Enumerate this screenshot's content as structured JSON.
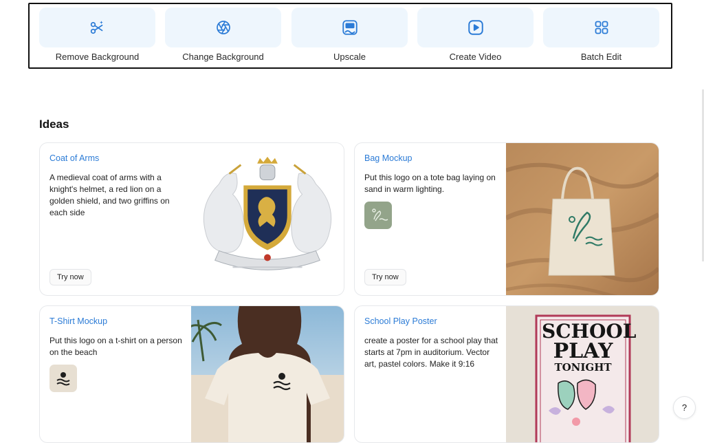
{
  "tools": [
    {
      "label": "Remove Background",
      "icon": "scissors-sparkle-icon"
    },
    {
      "label": "Change Background",
      "icon": "aperture-icon"
    },
    {
      "label": "Upscale",
      "icon": "hd-icon"
    },
    {
      "label": "Create Video",
      "icon": "play-icon"
    },
    {
      "label": "Batch Edit",
      "icon": "grid-icon"
    }
  ],
  "ideas": {
    "title": "Ideas",
    "cards": [
      {
        "title": "Coat of Arms",
        "description": "A medieval coat of arms with a knight's helmet, a red lion on a golden shield, and two griffins on each side",
        "button": "Try now"
      },
      {
        "title": "Bag Mockup",
        "description": "Put this logo on a tote bag laying on sand in warm lighting.",
        "button": "Try now"
      },
      {
        "title": "T-Shirt Mockup",
        "description": "Put this logo on a t-shirt on a person on the beach"
      },
      {
        "title": "School Play Poster",
        "description": "create a poster for a school play that starts at 7pm in auditorium. Vector art, pastel colors. Make it 9:16"
      }
    ]
  },
  "poster": {
    "line1": "SCHOOL",
    "line2": "PLAY",
    "line3": "TONIGHT"
  },
  "help": {
    "label": "?"
  },
  "colors": {
    "accent": "#2b7bd6",
    "tile": "#eef6fd"
  }
}
